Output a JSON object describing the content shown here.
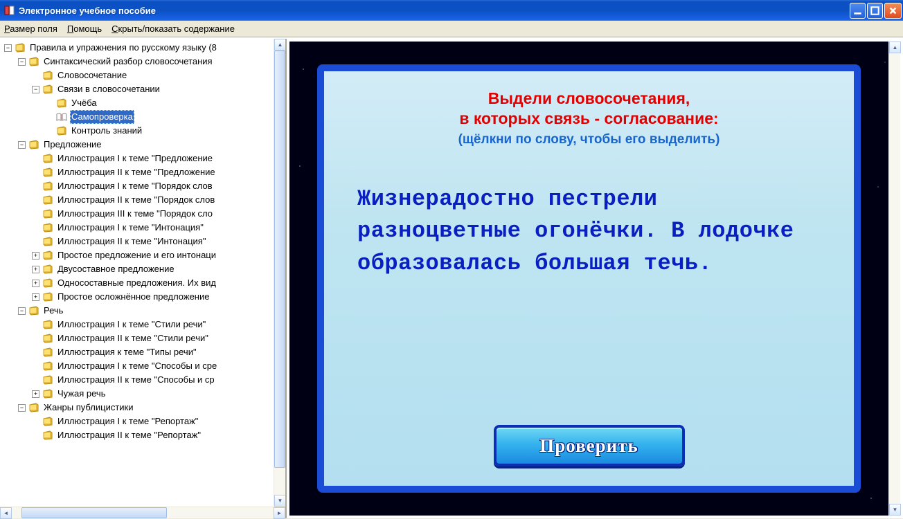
{
  "window": {
    "title": "Электронное учебное пособие"
  },
  "menu": {
    "field_size": "Размер поля",
    "field_size_u": "Р",
    "help": "Помощь",
    "help_u": "П",
    "toggle_toc": "Скрыть/показать содержание",
    "toggle_toc_u": "С"
  },
  "tree": [
    {
      "lvl": 0,
      "exp": "-",
      "icon": "closed",
      "label": "Правила и упражнения по русскому языку (8"
    },
    {
      "lvl": 1,
      "exp": "-",
      "icon": "closed",
      "label": "Синтаксический разбор словосочетания"
    },
    {
      "lvl": 2,
      "exp": "",
      "icon": "closed",
      "label": "Словосочетание"
    },
    {
      "lvl": 2,
      "exp": "-",
      "icon": "closed",
      "label": "Связи в словосочетании"
    },
    {
      "lvl": 3,
      "exp": "",
      "icon": "closed",
      "label": "Учёба"
    },
    {
      "lvl": 3,
      "exp": "",
      "icon": "open",
      "label": "Самопроверка",
      "sel": true
    },
    {
      "lvl": 3,
      "exp": "",
      "icon": "closed",
      "label": "Контроль знаний"
    },
    {
      "lvl": 1,
      "exp": "-",
      "icon": "closed",
      "label": "Предложение"
    },
    {
      "lvl": 2,
      "exp": "",
      "icon": "closed",
      "label": "Иллюстрация I к теме \"Предложение"
    },
    {
      "lvl": 2,
      "exp": "",
      "icon": "closed",
      "label": "Иллюстрация II к теме \"Предложение"
    },
    {
      "lvl": 2,
      "exp": "",
      "icon": "closed",
      "label": "Иллюстрация I к теме \"Порядок слов"
    },
    {
      "lvl": 2,
      "exp": "",
      "icon": "closed",
      "label": "Иллюстрация II к теме \"Порядок слов"
    },
    {
      "lvl": 2,
      "exp": "",
      "icon": "closed",
      "label": "Иллюстрация III к теме \"Порядок сло"
    },
    {
      "lvl": 2,
      "exp": "",
      "icon": "closed",
      "label": "Иллюстрация I к теме \"Интонация\""
    },
    {
      "lvl": 2,
      "exp": "",
      "icon": "closed",
      "label": "Иллюстрация II к теме \"Интонация\""
    },
    {
      "lvl": 2,
      "exp": "+",
      "icon": "closed",
      "label": "Простое предложение и его интонаци"
    },
    {
      "lvl": 2,
      "exp": "+",
      "icon": "closed",
      "label": "Двусоставное предложение"
    },
    {
      "lvl": 2,
      "exp": "+",
      "icon": "closed",
      "label": "Односоставные предложения. Их вид"
    },
    {
      "lvl": 2,
      "exp": "+",
      "icon": "closed",
      "label": "Простое осложнённое предложение"
    },
    {
      "lvl": 1,
      "exp": "-",
      "icon": "closed",
      "label": "Речь"
    },
    {
      "lvl": 2,
      "exp": "",
      "icon": "closed",
      "label": "Иллюстрация I к теме \"Стили речи\""
    },
    {
      "lvl": 2,
      "exp": "",
      "icon": "closed",
      "label": "Иллюстрация II к теме \"Стили речи\""
    },
    {
      "lvl": 2,
      "exp": "",
      "icon": "closed",
      "label": "Иллюстрация к теме \"Типы речи\""
    },
    {
      "lvl": 2,
      "exp": "",
      "icon": "closed",
      "label": "Иллюстрация I к теме \"Способы и сре"
    },
    {
      "lvl": 2,
      "exp": "",
      "icon": "closed",
      "label": "Иллюстрация II к теме \"Способы и ср"
    },
    {
      "lvl": 2,
      "exp": "+",
      "icon": "closed",
      "label": "Чужая речь"
    },
    {
      "lvl": 1,
      "exp": "-",
      "icon": "closed",
      "label": "Жанры публицистики"
    },
    {
      "lvl": 2,
      "exp": "",
      "icon": "closed",
      "label": "Иллюстрация I к теме \"Репортаж\""
    },
    {
      "lvl": 2,
      "exp": "",
      "icon": "closed",
      "label": "Иллюстрация II к теме \"Репортаж\""
    }
  ],
  "exercise": {
    "heading1": "Выдели словосочетания,",
    "heading2": "в которых связь - согласование:",
    "hint": "(щёлкни по слову, чтобы его выделить)",
    "text": "Жизнерадостно пестрели разноцветные огонёчки. В лодочке образовалась большая течь.",
    "button": "Проверить"
  }
}
